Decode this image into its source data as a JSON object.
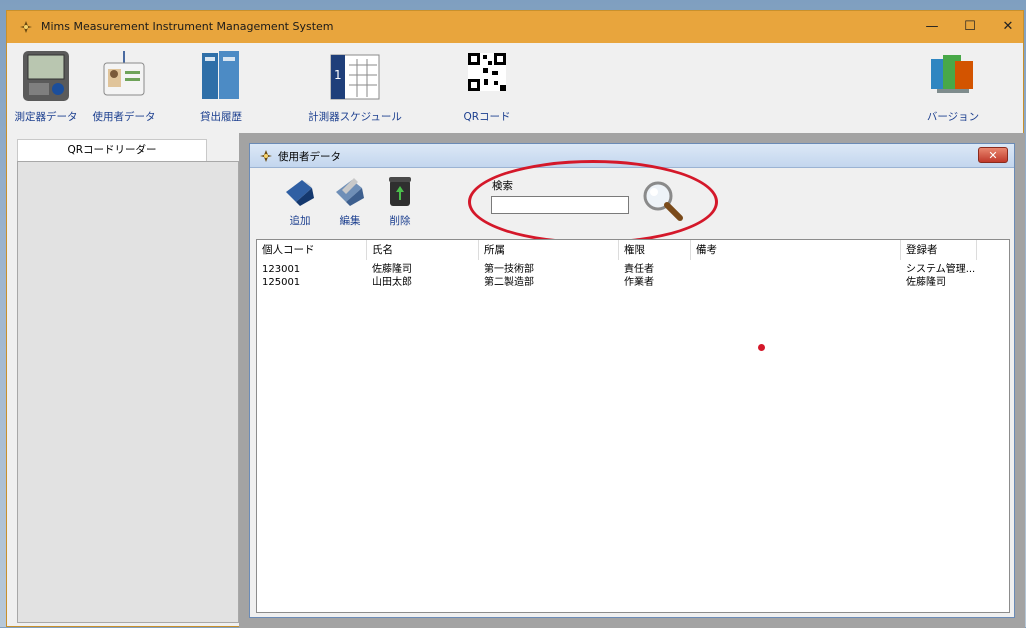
{
  "window": {
    "title": "Mims  Measurement Instrument Management System",
    "minimize": "—",
    "maximize": "☐",
    "close": "✕"
  },
  "toolbar": {
    "items": [
      {
        "label": "測定器データ"
      },
      {
        "label": "使用者データ"
      },
      {
        "label": "貸出履歴"
      },
      {
        "label": "計測器スケジュール"
      },
      {
        "label": "QRコード"
      },
      {
        "label": "バージョン"
      }
    ]
  },
  "left_panel": {
    "tab": "QRコードリーダー"
  },
  "child": {
    "title": "使用者データ",
    "close": "✕",
    "tools": {
      "add": "追加",
      "edit": "編集",
      "delete": "削除"
    },
    "search": {
      "label": "検索",
      "value": ""
    }
  },
  "grid": {
    "columns": [
      "個人コード",
      "氏名",
      "所属",
      "権限",
      "備考",
      "登録者"
    ],
    "rows": [
      [
        "123001",
        "佐藤隆司",
        "第一技術部",
        "責任者",
        "",
        "システム管理..."
      ],
      [
        "125001",
        "山田太郎",
        "第二製造部",
        "作業者",
        "",
        "佐藤隆司"
      ]
    ]
  },
  "colors": {
    "titlebar": "#e8a53d",
    "annotation": "#d4182a",
    "link_text": "#1c3f8f"
  },
  "icons": [
    "app-logo-icon",
    "instrument-data-icon",
    "user-data-icon",
    "loan-history-icon",
    "schedule-calendar-icon",
    "qr-code-icon",
    "version-icon",
    "add-icon",
    "edit-icon",
    "delete-trash-icon",
    "magnifier-icon"
  ]
}
